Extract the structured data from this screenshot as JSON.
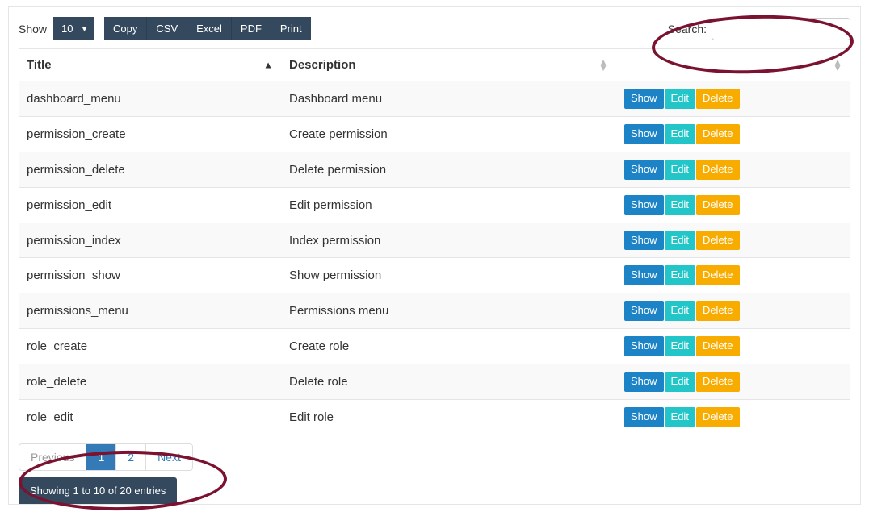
{
  "toolbar": {
    "show_label": "Show",
    "length_value": "10",
    "export": {
      "copy": "Copy",
      "csv": "CSV",
      "excel": "Excel",
      "pdf": "PDF",
      "print": "Print"
    },
    "search_label": "Search:"
  },
  "columns": {
    "title": "Title",
    "description": "Description",
    "actions": ""
  },
  "actions": {
    "show": "Show",
    "edit": "Edit",
    "delete": "Delete"
  },
  "rows": [
    {
      "title": "dashboard_menu",
      "desc": "Dashboard menu"
    },
    {
      "title": "permission_create",
      "desc": "Create permission"
    },
    {
      "title": "permission_delete",
      "desc": "Delete permission"
    },
    {
      "title": "permission_edit",
      "desc": "Edit permission"
    },
    {
      "title": "permission_index",
      "desc": "Index permission"
    },
    {
      "title": "permission_show",
      "desc": "Show permission"
    },
    {
      "title": "permissions_menu",
      "desc": "Permissions menu"
    },
    {
      "title": "role_create",
      "desc": "Create role"
    },
    {
      "title": "role_delete",
      "desc": "Delete role"
    },
    {
      "title": "role_edit",
      "desc": "Edit role"
    }
  ],
  "pagination": {
    "previous": "Previous",
    "page1": "1",
    "page2": "2",
    "next": "Next"
  },
  "info_text": "Showing 1 to 10 of 20 entries"
}
